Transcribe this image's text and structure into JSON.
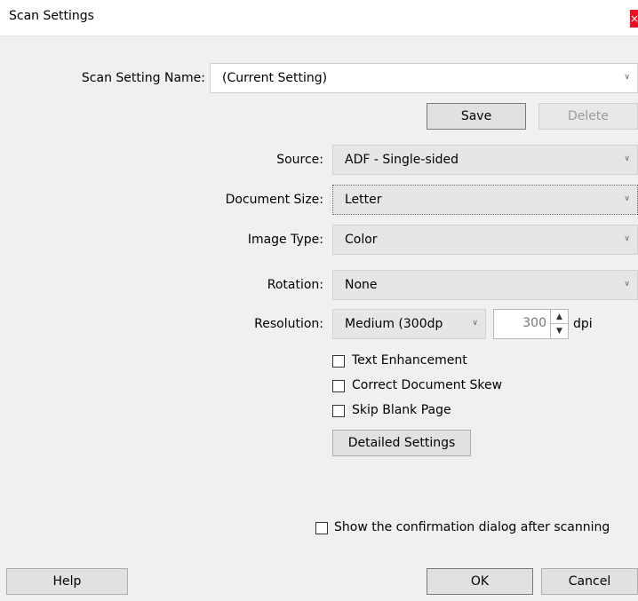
{
  "window": {
    "title": "Scan Settings",
    "close_glyph": "×"
  },
  "scan_setting_name": {
    "label": "Scan Setting Name:",
    "value": "(Current Setting)"
  },
  "actions": {
    "save_label": "Save",
    "delete_label": "Delete"
  },
  "source": {
    "label": "Source:",
    "value": "ADF - Single-sided"
  },
  "document_size": {
    "label": "Document Size:",
    "value": "Letter"
  },
  "image_type": {
    "label": "Image Type:",
    "value": "Color"
  },
  "rotation": {
    "label": "Rotation:",
    "value": "None"
  },
  "resolution": {
    "label": "Resolution:",
    "value": "Medium (300dp",
    "dpi_value": "300",
    "unit": "dpi"
  },
  "options": {
    "text_enhancement": {
      "label": "Text Enhancement",
      "checked": false
    },
    "correct_document_skew": {
      "label": "Correct Document Skew",
      "checked": false
    },
    "skip_blank_page": {
      "label": "Skip Blank Page",
      "checked": false
    }
  },
  "detailed_settings_label": "Detailed Settings",
  "confirmation": {
    "label": "Show the confirmation dialog after scanning",
    "checked": false
  },
  "footer": {
    "help_label": "Help",
    "ok_label": "OK",
    "cancel_label": "Cancel"
  },
  "icons": {
    "dropdown": "chevron-down-icon",
    "spin_up": "spin-up-icon",
    "spin_down": "spin-down-icon",
    "close": "close-icon"
  },
  "colors": {
    "close_button": "#e81123",
    "dialog_background": "#f0f0f0",
    "title_background": "#ffffff"
  }
}
